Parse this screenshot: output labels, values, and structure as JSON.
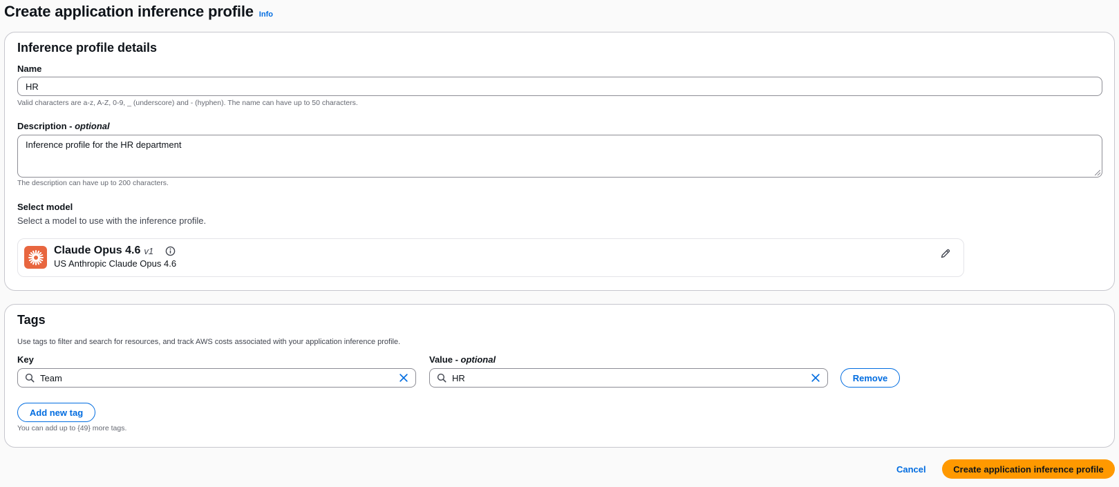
{
  "header": {
    "title": "Create application inference profile",
    "info_label": "Info"
  },
  "details": {
    "section_title": "Inference profile details",
    "name": {
      "label": "Name",
      "value": "HR",
      "hint": "Valid characters are a-z, A-Z, 0-9, _ (underscore) and - (hyphen). The name can have up to 50 characters."
    },
    "description": {
      "label": "Description",
      "label_suffix": "optional",
      "value": "Inference profile for the HR department",
      "hint": "The description can have up to 200 characters."
    },
    "model": {
      "label": "Select model",
      "subtext": "Select a model to use with the inference profile.",
      "name": "Claude Opus 4.6",
      "version": "v1",
      "provider_line": "US Anthropic Claude Opus 4.6",
      "logo_color": "#e8663f"
    }
  },
  "tags": {
    "section_title": "Tags",
    "description": "Use tags to filter and search for resources, and track AWS costs associated with your application inference profile.",
    "key_label": "Key",
    "value_label": "Value",
    "value_label_suffix": "optional",
    "rows": [
      {
        "key": "Team",
        "value": "HR",
        "remove_label": "Remove"
      }
    ],
    "add_label": "Add new tag",
    "limit_hint": "You can add up to {49} more tags."
  },
  "footer": {
    "cancel_label": "Cancel",
    "submit_label": "Create application inference profile"
  },
  "colors": {
    "accent": "#006ce0",
    "primary_button": "#ff9900"
  }
}
